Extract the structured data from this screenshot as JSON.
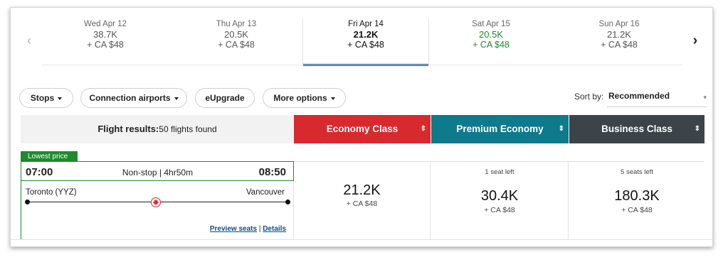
{
  "date_strip": {
    "prev_icon": "chevron-left-icon",
    "next_icon": "chevron-right-icon",
    "prev_glyph": "‹",
    "next_glyph": "›",
    "dates": [
      {
        "date": "Wed Apr 12",
        "points": "38.7K",
        "fee": "+ CA $48",
        "state": "normal"
      },
      {
        "date": "Thu Apr 13",
        "points": "20.5K",
        "fee": "+ CA $48",
        "state": "normal"
      },
      {
        "date": "Fri Apr 14",
        "points": "21.2K",
        "fee": "+ CA $48",
        "state": "selected"
      },
      {
        "date": "Sat Apr 15",
        "points": "20.5K",
        "fee": "+ CA $48",
        "state": "lowest"
      },
      {
        "date": "Sun Apr 16",
        "points": "21.2K",
        "fee": "+ CA $48",
        "state": "normal"
      }
    ]
  },
  "filters": {
    "stops": "Stops",
    "connection_airports": "Connection airports",
    "eupgrade": "eUpgrade",
    "more_options": "More options",
    "sort_by_label": "Sort by:",
    "sort_value": "Recommended"
  },
  "results_header": {
    "label": "Flight results:",
    "count": "50 flights found"
  },
  "cabins": {
    "economy": "Economy Class",
    "premium": "Premium Economy",
    "business": "Business Class",
    "sort_glyph": "⇕"
  },
  "flight": {
    "badge": "Lowest price",
    "depart": "07:00",
    "arrive": "08:50",
    "summary": "Non-stop | 4hr50m",
    "origin": "Toronto (YYZ)",
    "destination": "Vancouver",
    "preview_seats": "Preview seats",
    "separator": "|",
    "details": "Details",
    "fares": {
      "economy": {
        "seats": "",
        "price": "21.2K",
        "fee": "+ CA $48"
      },
      "premium": {
        "seats": "1 seat left",
        "price": "30.4K",
        "fee": "+ CA $48"
      },
      "business": {
        "seats": "5 seats left",
        "price": "180.3K",
        "fee": "+ CA $48"
      }
    }
  },
  "colors": {
    "economy": "#d8292f",
    "premium": "#0e7a8c",
    "business": "#3d4449",
    "lowest_green": "#1e8a2e",
    "selected_blue": "#0a4d8c"
  }
}
